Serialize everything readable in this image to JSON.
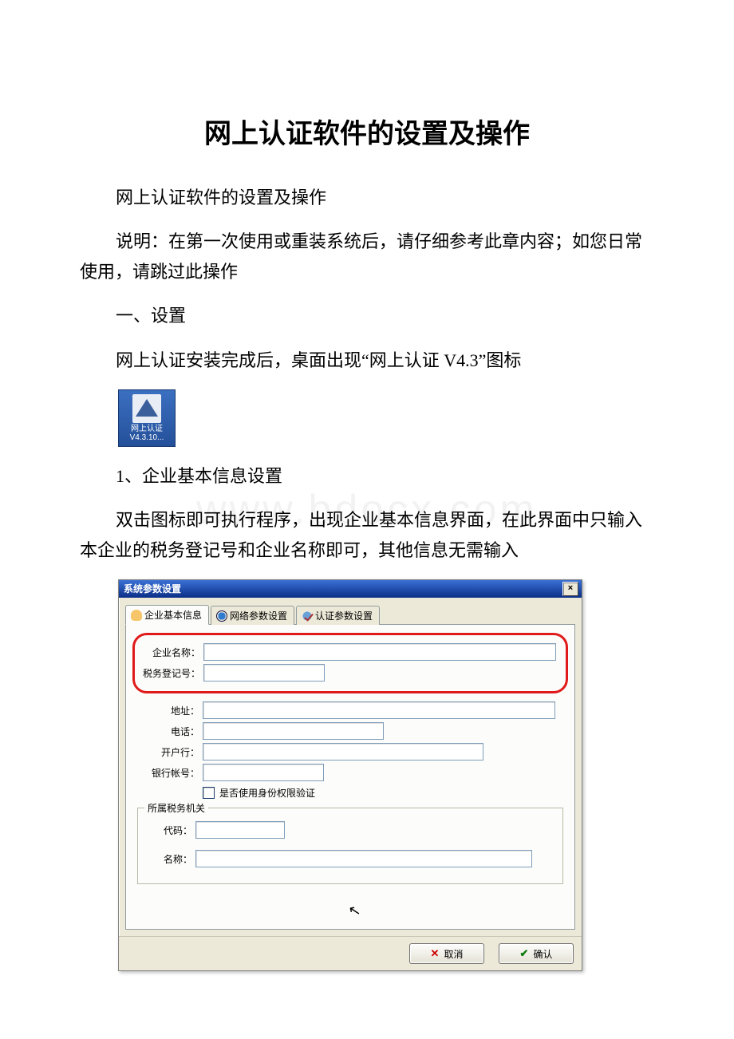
{
  "doc": {
    "title": "网上认证软件的设置及操作",
    "p1": "网上认证软件的设置及操作",
    "p2": "说明：在第一次使用或重装系统后，请仔细参考此章内容；如您日常使用，请跳过此操作",
    "p3": "一、设置",
    "p4": "网上认证安装完成后，桌面出现“网上认证 V4.3”图标",
    "p5": "1、企业基本信息设置",
    "p6": "双击图标即可执行程序，出现企业基本信息界面，在此界面中只输入本企业的税务登记号和企业名称即可，其他信息无需输入"
  },
  "desktop_icon": {
    "line1": "网上认证",
    "line2": "V4.3.10..."
  },
  "dialog": {
    "title": "系统参数设置",
    "close_x": "×",
    "tabs": {
      "t1": "企业基本信息",
      "t2": "网络参数设置",
      "t3": "认证参数设置"
    },
    "labels": {
      "company": "企业名称：",
      "tax": "税务登记号：",
      "addr": "地址：",
      "phone": "电话：",
      "bank": "开户行：",
      "account": "银行帐号：",
      "chk": "是否使用身份权限验证",
      "group": "所属税务机关",
      "code": "代码：",
      "name": "名称："
    },
    "buttons": {
      "cancel": "取消",
      "ok": "确认"
    }
  },
  "watermark": "www.bdocx.com"
}
